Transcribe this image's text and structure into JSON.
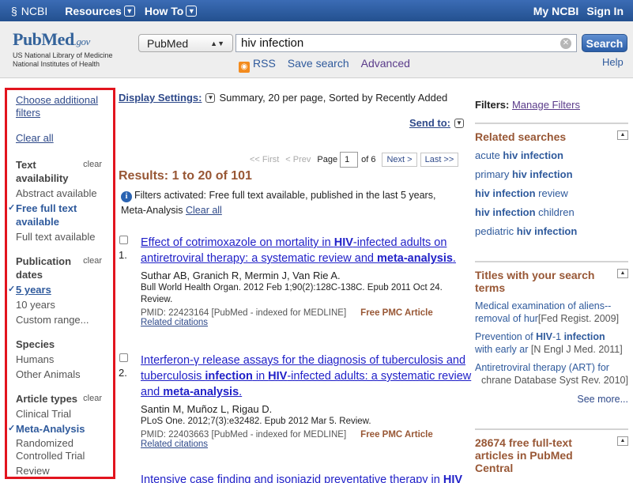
{
  "topbar": {
    "ncbi": "NCBI",
    "resources": "Resources",
    "howto": "How To",
    "myncbi": "My NCBI",
    "signin": "Sign In"
  },
  "header": {
    "logo_pub": "Pub",
    "logo_med": "Med",
    "logo_gov": ".gov",
    "logo_line1": "US National Library of Medicine",
    "logo_line2": "National Institutes of Health",
    "database": "PubMed",
    "search_value": "hiv infection",
    "search_button": "Search",
    "rss": "RSS",
    "save_search": "Save search",
    "advanced": "Advanced",
    "help": "Help"
  },
  "left": {
    "choose": "Choose additional filters",
    "clear_all": "Clear all",
    "clear": "clear",
    "groups": [
      {
        "title": "Text availability",
        "items": [
          "Abstract available",
          "Free full text available",
          "Full text available"
        ]
      },
      {
        "title": "Publication dates",
        "items": [
          "5 years",
          "10 years",
          "Custom range..."
        ]
      },
      {
        "title": "Species",
        "items": [
          "Humans",
          "Other Animals"
        ]
      },
      {
        "title": "Article types",
        "items": [
          "Clinical Trial",
          "Meta-Analysis",
          "Randomized Controlled Trial",
          "Review"
        ]
      }
    ]
  },
  "main": {
    "display_settings": "Display Settings:",
    "display_value": "Summary, 20 per page, Sorted by Recently Added",
    "send_to": "Send to:",
    "pager": {
      "first": "<< First",
      "prev": "< Prev",
      "page_label": "Page",
      "page": "1",
      "of": "of 6",
      "next": "Next >",
      "last": "Last >>"
    },
    "results_title": "Results: 1 to 20 of 101",
    "filters_activated": "Filters activated: Free full text available, published in the last 5 years, Meta-Analysis",
    "clear_all": "Clear all",
    "results": [
      {
        "num": "1.",
        "title_parts": [
          "Effect of cotrimoxazole on mortality in ",
          "HIV",
          "-infected adults on antiretroviral therapy: a systematic review and ",
          "meta-analysis",
          "."
        ],
        "authors": "Suthar AB, Granich R, Mermin J, Van Rie A.",
        "journal": "Bull World Health Organ. 2012 Feb 1;90(2):128C-138C. Epub 2011 Oct 24. Review.",
        "pmid": "PMID: 22423164 [PubMed - indexed for MEDLINE]",
        "pmc": "Free PMC Article",
        "related": "Related citations"
      },
      {
        "num": "2.",
        "title_parts": [
          "Interferon-γ release assays for the diagnosis of tuberculosis and tuberculosis ",
          "infection",
          " in ",
          "HIV",
          "-infected adults: a systematic review and ",
          "meta-analysis",
          "."
        ],
        "authors": "Santin M, Muñoz L, Rigau D.",
        "journal": "PLoS One. 2012;7(3):e32482. Epub 2012 Mar 5. Review.",
        "pmid": "PMID: 22403663 [PubMed - indexed for MEDLINE]",
        "pmc": "Free PMC Article",
        "related": "Related citations"
      },
      {
        "num": "3.",
        "title_parts": [
          "Intensive case finding and isoniazid preventative therapy in ",
          "HIV"
        ]
      }
    ]
  },
  "right": {
    "filters_label": "Filters:",
    "manage": "Manage Filters",
    "related_title": "Related searches",
    "related": [
      {
        "pre": "acute ",
        "bold": "hiv infection",
        "post": ""
      },
      {
        "pre": "primary ",
        "bold": "hiv infection",
        "post": ""
      },
      {
        "pre": "",
        "bold": "hiv infection",
        "post": " review"
      },
      {
        "pre": "",
        "bold": "hiv infection",
        "post": " children"
      },
      {
        "pre": "pediatric ",
        "bold": "hiv infection",
        "post": ""
      }
    ],
    "titles_title": "Titles with your search terms",
    "titles": [
      {
        "line1": "Medical examination of aliens--",
        "line2": "removal of hur",
        "src": "[Fed Regist. 2009]"
      },
      {
        "line1_pre": "Prevention of ",
        "line1_bold": "HIV",
        "line1_mid": "-1 ",
        "line1_bold2": "infection",
        "line2": "with early ar",
        "src": "[N Engl J Med. 2011]"
      },
      {
        "line1": "Antiretroviral therapy (ART) for",
        "line2": "chrane Database Syst Rev. 2010]",
        "src": ""
      }
    ],
    "see_more": "See more...",
    "free_title": "28674 free full-text articles in PubMed Central"
  }
}
